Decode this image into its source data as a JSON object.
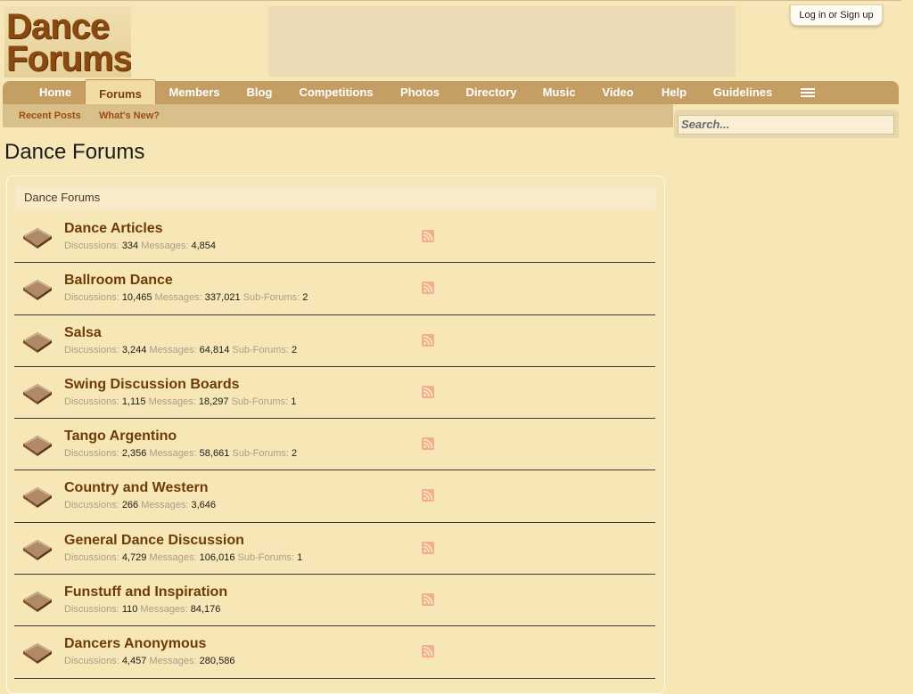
{
  "header": {
    "logo_line1": "Dance",
    "logo_line2": "Forums",
    "login_label": "Log in or Sign up"
  },
  "nav": {
    "tabs": [
      {
        "label": "Home"
      },
      {
        "label": "Forums",
        "active": true
      },
      {
        "label": "Members"
      },
      {
        "label": "Blog"
      },
      {
        "label": "Competitions"
      },
      {
        "label": "Photos"
      },
      {
        "label": "Directory"
      },
      {
        "label": "Music"
      },
      {
        "label": "Video"
      },
      {
        "label": "Help"
      },
      {
        "label": "Guidelines"
      }
    ],
    "menu_icon": "hamburger-menu-icon"
  },
  "subnav": {
    "recent_posts": "Recent Posts",
    "whats_new": "What's New?"
  },
  "search": {
    "placeholder": "Search..."
  },
  "main": {
    "page_title": "Dance Forums",
    "panel_header": "Dance Forums",
    "forums": [
      {
        "title": "Dance Articles",
        "discussions": "334",
        "messages": "4,854",
        "sub_forums": null
      },
      {
        "title": "Ballroom Dance",
        "discussions": "10,465",
        "messages": "337,021",
        "sub_forums": "2"
      },
      {
        "title": "Salsa",
        "discussions": "3,244",
        "messages": "64,814",
        "sub_forums": "2"
      },
      {
        "title": "Swing Discussion Boards",
        "discussions": "1,115",
        "messages": "18,297",
        "sub_forums": "1"
      },
      {
        "title": "Tango Argentino",
        "discussions": "2,356",
        "messages": "58,661",
        "sub_forums": "2"
      },
      {
        "title": "Country and Western",
        "discussions": "266",
        "messages": "3,646",
        "sub_forums": null
      },
      {
        "title": "General Dance Discussion",
        "discussions": "4,729",
        "messages": "106,016",
        "sub_forums": "1"
      },
      {
        "title": "Funstuff and Inspiration",
        "discussions": "110",
        "messages": "84,176",
        "sub_forums": null
      },
      {
        "title": "Dancers Anonymous",
        "discussions": "4,457",
        "messages": "280,586",
        "sub_forums": null
      }
    ],
    "labels": {
      "discussions": "Discussions:",
      "messages": "Messages:",
      "sub_forums": "Sub-Forums:"
    }
  },
  "colors": {
    "background": "#f7e7b7",
    "nav_bar": "#c59e63",
    "forum_title": "#6e3b08",
    "rss": "#f0b08a"
  }
}
